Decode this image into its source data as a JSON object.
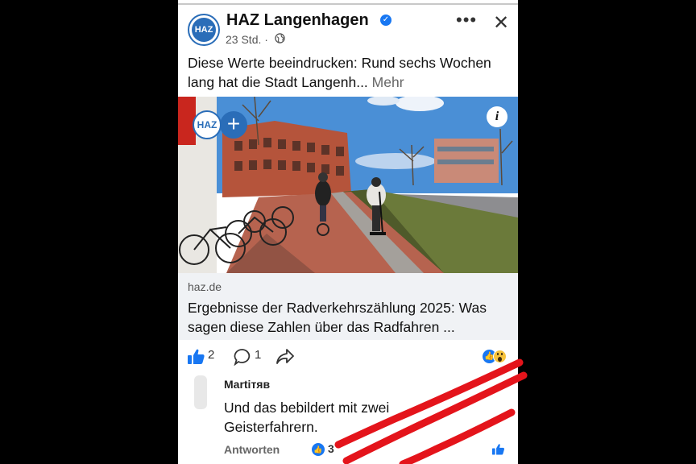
{
  "post": {
    "avatar_text": "HAZ",
    "page_name": "HAZ Langenhagen",
    "time": "23 Std. ·",
    "text_main": "Diese Werte beeindrucken: Rund sechs Wochen lang hat die Stadt Langenh...",
    "text_more": "Mehr",
    "image_badge_text": "HAZ"
  },
  "link": {
    "domain": "haz.de",
    "title": "Ergebnisse der Radverkehrszählung 2025: Was sagen diese Zahlen über das Radfahren ..."
  },
  "actions": {
    "like_count": "2",
    "comment_count": "1"
  },
  "comment": {
    "author": "Martiтяв",
    "text": "Und das bebildert mit zwei Geisterfahrern.",
    "reply_label": "Antworten",
    "like_count": "3"
  },
  "colors": {
    "brand_blue": "#1877f2",
    "haz_blue": "#2a6db8",
    "annotation_red": "#e4141b"
  }
}
